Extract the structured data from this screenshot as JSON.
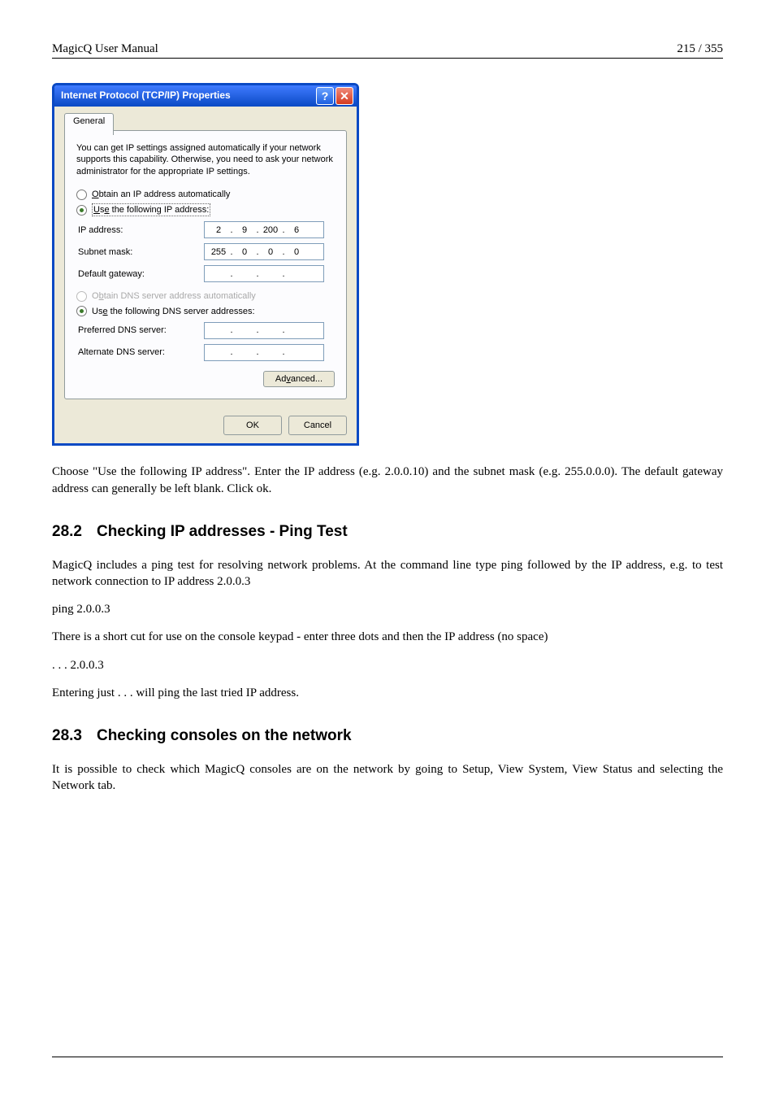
{
  "header": {
    "left": "MagicQ User Manual",
    "right": "215 / 355"
  },
  "dialog": {
    "title": "Internet Protocol (TCP/IP) Properties",
    "help_glyph": "?",
    "close_glyph": "✕",
    "tab": "General",
    "description": "You can get IP settings assigned automatically if your network supports this capability. Otherwise, you need to ask your network administrator for the appropriate IP settings.",
    "r_obtain_ip": "Obtain an IP address automatically",
    "r_use_ip": "Use the following IP address:",
    "lab_ip": "IP address:",
    "lab_mask": "Subnet mask:",
    "lab_gw": "Default gateway:",
    "ip": {
      "a": "2",
      "b": "9",
      "c": "200",
      "d": "6"
    },
    "mask": {
      "a": "255",
      "b": "0",
      "c": "0",
      "d": "0"
    },
    "gw": {
      "a": "",
      "b": "",
      "c": "",
      "d": ""
    },
    "r_obtain_dns": "Obtain DNS server address automatically",
    "r_use_dns": "Use the following DNS server addresses:",
    "lab_pdns": "Preferred DNS server:",
    "lab_adns": "Alternate DNS server:",
    "pdns": {
      "a": "",
      "b": "",
      "c": "",
      "d": ""
    },
    "adns": {
      "a": "",
      "b": "",
      "c": "",
      "d": ""
    },
    "btn_adv": "Advanced...",
    "btn_ok": "OK",
    "btn_cancel": "Cancel"
  },
  "para_choose": "Choose \"Use the following IP address\". Enter the IP address (e.g. 2.0.0.10) and the subnet mask (e.g. 255.0.0.0). The default gateway address can generally be left blank. Click ok.",
  "sec282_no": "28.2",
  "sec282_title": "Checking IP addresses - Ping Test",
  "sec282_p1": "MagicQ includes a ping test for resolving network problems. At the command line type ping followed by the IP address, e.g. to test network connection to IP address 2.0.0.3",
  "sec282_p2": "ping 2.0.0.3",
  "sec282_p3": "There is a short cut for use on the console keypad - enter three dots and then the IP address (no space)",
  "sec282_p4": ". . . 2.0.0.3",
  "sec282_p5": "Entering just . . .  will ping the last tried IP address.",
  "sec283_no": "28.3",
  "sec283_title": "Checking consoles on the network",
  "sec283_p1": "It is possible to check which MagicQ consoles are on the network by going to Setup, View System, View Status and selecting the Network tab."
}
